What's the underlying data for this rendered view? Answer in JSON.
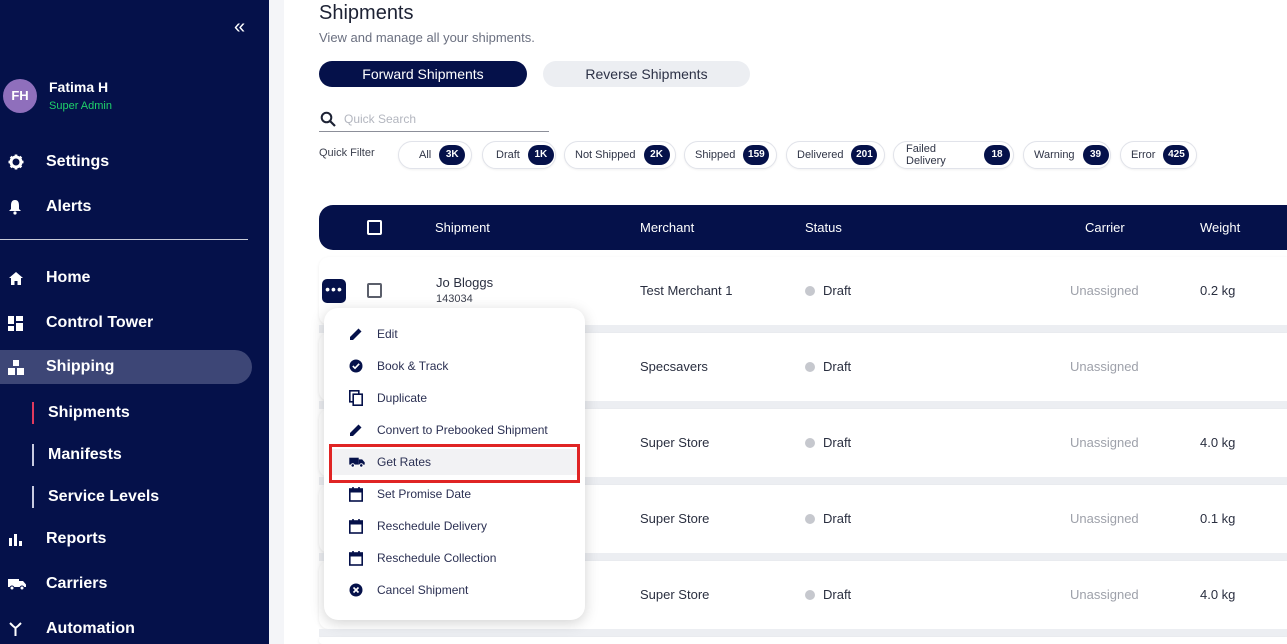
{
  "sidebar": {
    "collapse_glyph": "«",
    "user": {
      "initials": "FH",
      "name": "Fatima H",
      "role": "Super Admin"
    },
    "top_items": [
      {
        "label": "Settings",
        "icon": "gear-icon"
      },
      {
        "label": "Alerts",
        "icon": "bell-icon"
      }
    ],
    "items": [
      {
        "label": "Home",
        "icon": "home-icon"
      },
      {
        "label": "Control Tower",
        "icon": "dashboard-icon"
      },
      {
        "label": "Shipping",
        "icon": "shipping-icon"
      },
      {
        "label": "Reports",
        "icon": "bar-chart-icon"
      },
      {
        "label": "Carriers",
        "icon": "truck-icon"
      },
      {
        "label": "Automation",
        "icon": "automation-icon"
      }
    ],
    "sub_items": [
      "Shipments",
      "Manifests",
      "Service Levels"
    ]
  },
  "page": {
    "title": "Shipments",
    "subtitle": "View and manage all your shipments.",
    "tabs": [
      "Forward Shipments",
      "Reverse Shipments"
    ],
    "search_placeholder": "Quick Search",
    "quick_filter_label": "Quick Filter",
    "filters": [
      {
        "label": "All",
        "count": "3K"
      },
      {
        "label": "Draft",
        "count": "1K"
      },
      {
        "label": "Not Shipped",
        "count": "2K"
      },
      {
        "label": "Shipped",
        "count": "159"
      },
      {
        "label": "Delivered",
        "count": "201"
      },
      {
        "label": "Failed Delivery",
        "count": "18"
      },
      {
        "label": "Warning",
        "count": "39"
      },
      {
        "label": "Error",
        "count": "425"
      }
    ]
  },
  "table": {
    "headers": {
      "shipment": "Shipment",
      "merchant": "Merchant",
      "status": "Status",
      "carrier": "Carrier",
      "weight": "Weight"
    },
    "rows": [
      {
        "name": "Jo Bloggs",
        "id": "143034",
        "merchant": "Test Merchant 1",
        "status": "Draft",
        "carrier": "Unassigned",
        "weight": "0.2 kg"
      },
      {
        "name": "",
        "id": "",
        "merchant": "Specsavers",
        "status": "Draft",
        "carrier": "Unassigned",
        "weight": ""
      },
      {
        "name": "",
        "id": "",
        "merchant": "Super Store",
        "status": "Draft",
        "carrier": "Unassigned",
        "weight": "4.0 kg"
      },
      {
        "name": "",
        "id": "",
        "merchant": "Super Store",
        "status": "Draft",
        "carrier": "Unassigned",
        "weight": "0.1 kg"
      },
      {
        "name": "",
        "id": "",
        "merchant": "Super Store",
        "status": "Draft",
        "carrier": "Unassigned",
        "weight": "4.0 kg"
      }
    ]
  },
  "row_menu": {
    "button_glyph": "•••",
    "items": [
      {
        "label": "Edit",
        "icon": "pencil-icon"
      },
      {
        "label": "Book & Track",
        "icon": "check-circle-icon"
      },
      {
        "label": "Duplicate",
        "icon": "copy-icon"
      },
      {
        "label": "Convert to Prebooked Shipment",
        "icon": "pencil-icon"
      },
      {
        "label": "Get Rates",
        "icon": "truck-icon"
      },
      {
        "label": "Set Promise Date",
        "icon": "calendar-icon"
      },
      {
        "label": "Reschedule Delivery",
        "icon": "calendar-icon"
      },
      {
        "label": "Reschedule Collection",
        "icon": "calendar-icon"
      },
      {
        "label": "Cancel Shipment",
        "icon": "cancel-circle-icon"
      }
    ],
    "highlighted": "Get Rates"
  },
  "colors": {
    "navy": "#05114a",
    "highlight": "#e02424",
    "success": "#1fd26a",
    "accent": "#e03a5e"
  }
}
